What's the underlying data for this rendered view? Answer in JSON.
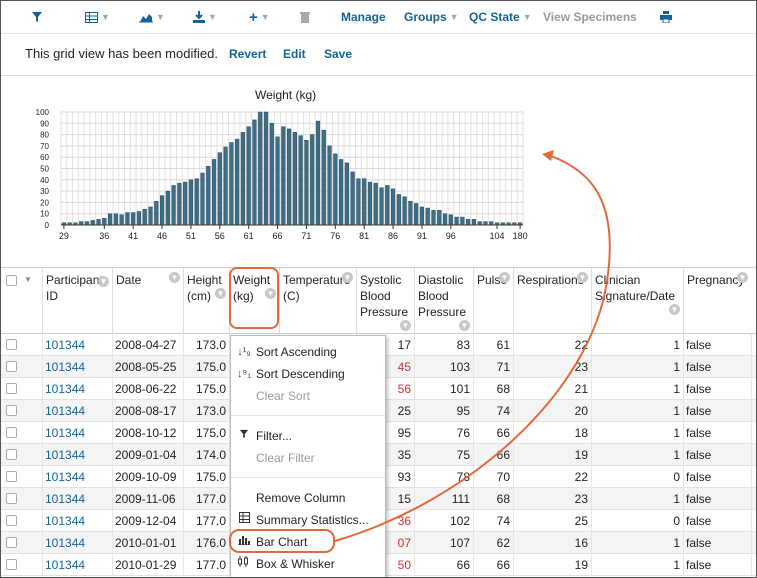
{
  "toolbar": {
    "filter_icon": "filter-icon",
    "grid_icon": "grid-icon",
    "chart_icon": "chart-icon",
    "export_icon": "export-icon",
    "insert_icon": "plus-icon",
    "delete_icon": "trash-icon",
    "manage": "Manage",
    "groups": "Groups",
    "qc_state": "QC State",
    "view_specimens": "View Specimens",
    "print_icon": "print-icon"
  },
  "msgbar": {
    "message": "This grid view has been modified.",
    "revert": "Revert",
    "edit": "Edit",
    "save": "Save"
  },
  "chart_data": {
    "type": "bar",
    "title": "Weight (kg)",
    "xlabel": "",
    "ylabel": "",
    "ylim": [
      0,
      100
    ],
    "yticks": [
      0,
      10,
      20,
      30,
      40,
      50,
      60,
      70,
      80,
      90,
      100
    ],
    "xticks": [
      "29",
      "36",
      "41",
      "46",
      "51",
      "56",
      "61",
      "66",
      "71",
      "76",
      "81",
      "86",
      "91",
      "96",
      "104",
      "180"
    ],
    "categories": [
      "29",
      "30",
      "31",
      "32",
      "33",
      "34",
      "35",
      "36",
      "37",
      "38",
      "39",
      "40",
      "41",
      "42",
      "43",
      "44",
      "45",
      "46",
      "47",
      "48",
      "49",
      "50",
      "51",
      "52",
      "53",
      "54",
      "55",
      "56",
      "57",
      "58",
      "59",
      "60",
      "61",
      "62",
      "63",
      "64",
      "65",
      "66",
      "67",
      "68",
      "69",
      "70",
      "71",
      "72",
      "73",
      "74",
      "75",
      "76",
      "77",
      "78",
      "79",
      "80",
      "81",
      "82",
      "83",
      "84",
      "85",
      "86",
      "87",
      "88",
      "89",
      "90",
      "91",
      "92",
      "93",
      "94",
      "95",
      "96",
      "97",
      "98",
      "99",
      "100",
      "101",
      "102",
      "103",
      "104",
      "105",
      "106",
      "107",
      "180"
    ],
    "values": [
      2,
      2,
      2,
      3,
      3,
      4,
      5,
      6,
      10,
      10,
      9,
      11,
      11,
      12,
      14,
      16,
      21,
      26,
      30,
      35,
      37,
      38,
      40,
      41,
      46,
      52,
      58,
      64,
      69,
      73,
      76,
      82,
      87,
      93,
      100,
      100,
      90,
      78,
      87,
      85,
      82,
      79,
      75,
      80,
      92,
      84,
      70,
      63,
      58,
      55,
      47,
      41,
      41,
      38,
      37,
      33,
      35,
      32,
      27,
      25,
      21,
      19,
      16,
      15,
      13,
      13,
      10,
      9,
      7,
      7,
      5,
      5,
      3,
      3,
      3,
      2,
      2,
      2,
      2,
      2
    ]
  },
  "grid": {
    "headers": [
      {
        "label": "Participant ID"
      },
      {
        "label": "Date"
      },
      {
        "label": "Height (cm)"
      },
      {
        "label": "Weight (kg)"
      },
      {
        "label": "Temperature (C)"
      },
      {
        "label": "Systolic Blood Pressure"
      },
      {
        "label": "Diastolic Blood Pressure"
      },
      {
        "label": "Pulse"
      },
      {
        "label": "Respirations"
      },
      {
        "label": "Clinician Signature/Date"
      },
      {
        "label": "Pregnancy"
      }
    ],
    "rows": [
      {
        "pid": "101344",
        "date": "2008-04-27",
        "height": "173.0",
        "sys": "17",
        "dia": "83",
        "pulse": "61",
        "resp": "22",
        "clin": "1",
        "preg": "false"
      },
      {
        "pid": "101344",
        "date": "2008-05-25",
        "height": "175.0",
        "sys": "45",
        "dia": "103",
        "pulse": "71",
        "resp": "23",
        "clin": "1",
        "preg": "false"
      },
      {
        "pid": "101344",
        "date": "2008-06-22",
        "height": "175.0",
        "sys": "56",
        "dia": "101",
        "pulse": "68",
        "resp": "21",
        "clin": "1",
        "preg": "false"
      },
      {
        "pid": "101344",
        "date": "2008-08-17",
        "height": "173.0",
        "sys": "25",
        "dia": "95",
        "pulse": "74",
        "resp": "20",
        "clin": "1",
        "preg": "false"
      },
      {
        "pid": "101344",
        "date": "2008-10-12",
        "height": "175.0",
        "sys": "95",
        "dia": "76",
        "pulse": "66",
        "resp": "18",
        "clin": "1",
        "preg": "false"
      },
      {
        "pid": "101344",
        "date": "2009-01-04",
        "height": "174.0",
        "sys": "35",
        "dia": "75",
        "pulse": "66",
        "resp": "19",
        "clin": "1",
        "preg": "false"
      },
      {
        "pid": "101344",
        "date": "2009-10-09",
        "height": "175.0",
        "sys": "93",
        "dia": "78",
        "pulse": "70",
        "resp": "22",
        "clin": "0",
        "preg": "false"
      },
      {
        "pid": "101344",
        "date": "2009-11-06",
        "height": "177.0",
        "sys": "15",
        "dia": "111",
        "pulse": "68",
        "resp": "23",
        "clin": "1",
        "preg": "false"
      },
      {
        "pid": "101344",
        "date": "2009-12-04",
        "height": "177.0",
        "sys": "36",
        "dia": "102",
        "pulse": "74",
        "resp": "25",
        "clin": "0",
        "preg": "false"
      },
      {
        "pid": "101344",
        "date": "2010-01-01",
        "height": "176.0",
        "sys": "07",
        "dia": "107",
        "pulse": "62",
        "resp": "16",
        "clin": "1",
        "preg": "false"
      },
      {
        "pid": "101344",
        "date": "2010-01-29",
        "height": "177.0",
        "sys": "50",
        "dia": "66",
        "pulse": "66",
        "resp": "19",
        "clin": "1",
        "preg": "false"
      }
    ],
    "sys_red_rows": [
      1,
      2,
      8,
      9,
      10
    ]
  },
  "menu": {
    "sort_ascending": "Sort Ascending",
    "sort_descending": "Sort Descending",
    "clear_sort": "Clear Sort",
    "filter": "Filter...",
    "clear_filter": "Clear Filter",
    "remove_column": "Remove Column",
    "summary_statistics": "Summary Statistics...",
    "bar_chart": "Bar Chart",
    "box_whisker": "Box & Whisker"
  },
  "colors": {
    "link": "#126495",
    "bar_fill": "#3f6f86",
    "highlight": "#e06a3b",
    "red_value": "#d32f2f"
  }
}
